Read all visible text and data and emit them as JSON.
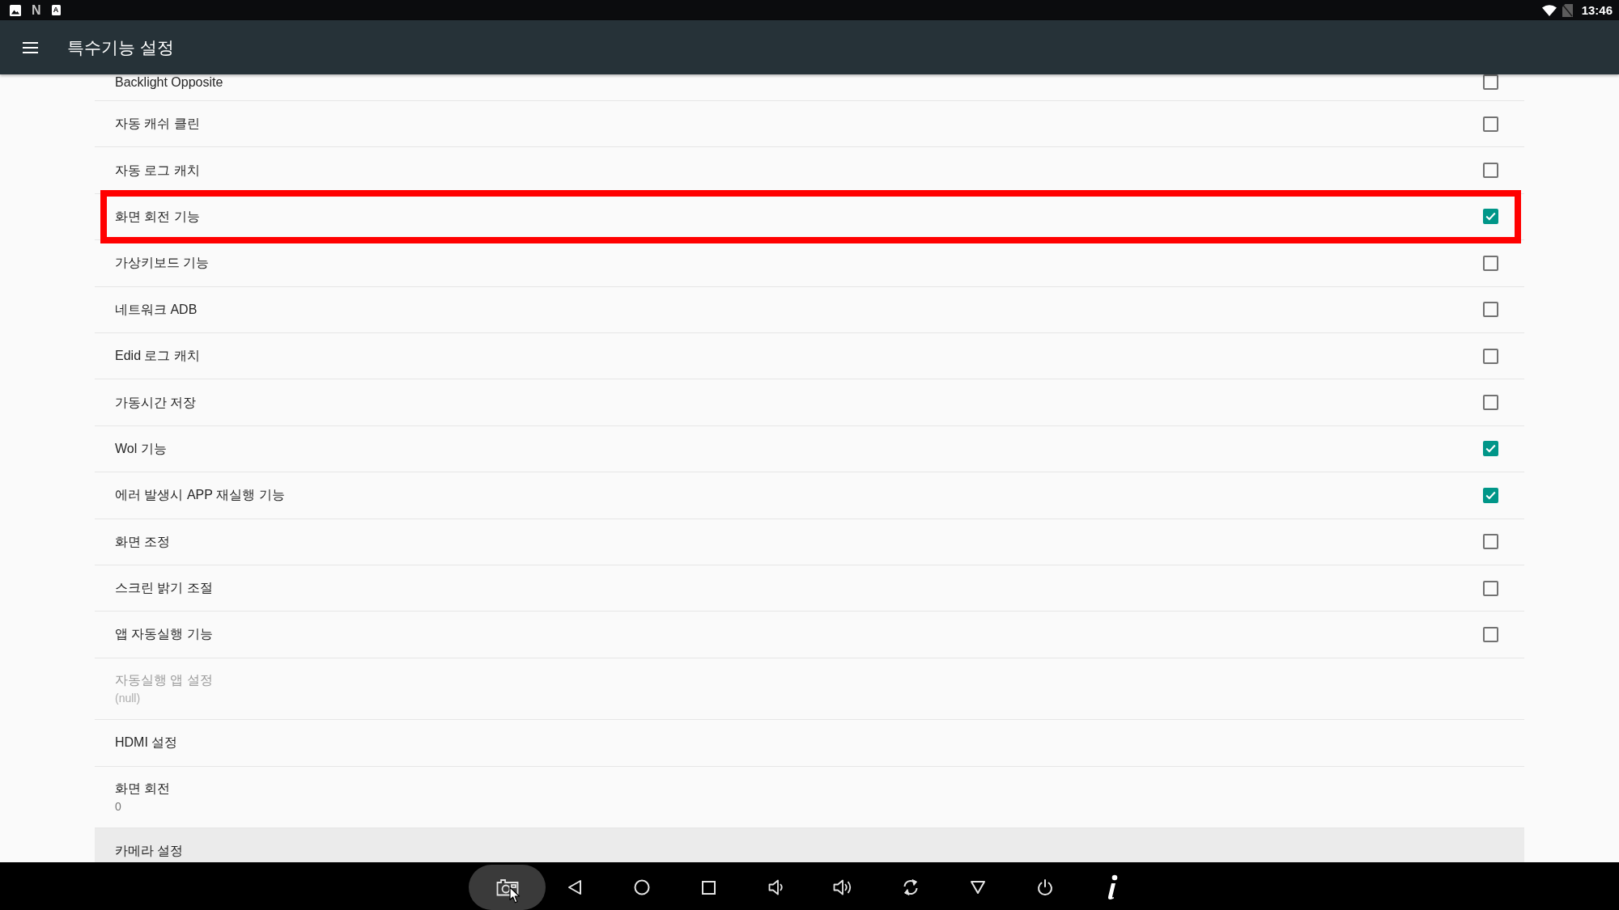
{
  "status_bar": {
    "notifications": [
      {
        "kind": "image"
      },
      {
        "kind": "letter",
        "glyph": "N"
      },
      {
        "kind": "tile",
        "glyph": "A"
      }
    ],
    "time": "13:46"
  },
  "app_bar": {
    "title": "특수기능 설정"
  },
  "settings": [
    {
      "kind": "checkbox",
      "title": "Backlight Opposite",
      "checked": false,
      "disabled": false,
      "highlighted": false,
      "focused": false
    },
    {
      "kind": "checkbox",
      "title": "자동 캐쉬 클린",
      "checked": false,
      "disabled": false,
      "highlighted": false,
      "focused": false
    },
    {
      "kind": "checkbox",
      "title": "자동 로그 캐치",
      "checked": false,
      "disabled": false,
      "highlighted": false,
      "focused": false
    },
    {
      "kind": "checkbox",
      "title": "화면 회전 기능",
      "checked": true,
      "disabled": false,
      "highlighted": true,
      "focused": false
    },
    {
      "kind": "checkbox",
      "title": "가상키보드 기능",
      "checked": false,
      "disabled": false,
      "highlighted": false,
      "focused": false
    },
    {
      "kind": "checkbox",
      "title": "네트워크 ADB",
      "checked": false,
      "disabled": false,
      "highlighted": false,
      "focused": false
    },
    {
      "kind": "checkbox",
      "title": "Edid 로그 캐치",
      "checked": false,
      "disabled": false,
      "highlighted": false,
      "focused": false
    },
    {
      "kind": "checkbox",
      "title": "가동시간 저장",
      "checked": false,
      "disabled": false,
      "highlighted": false,
      "focused": false
    },
    {
      "kind": "checkbox",
      "title": "Wol 기능",
      "checked": true,
      "disabled": false,
      "highlighted": false,
      "focused": false
    },
    {
      "kind": "checkbox",
      "title": "에러 발생시 APP 재실행 기능",
      "checked": true,
      "disabled": false,
      "highlighted": false,
      "focused": false
    },
    {
      "kind": "checkbox",
      "title": "화면 조정",
      "checked": false,
      "disabled": false,
      "highlighted": false,
      "focused": false
    },
    {
      "kind": "checkbox",
      "title": "스크린 밝기 조절",
      "checked": false,
      "disabled": false,
      "highlighted": false,
      "focused": false
    },
    {
      "kind": "checkbox",
      "title": "앱 자동실행 기능",
      "checked": false,
      "disabled": false,
      "highlighted": false,
      "focused": false
    },
    {
      "kind": "link",
      "title": "자동실행 앱 설정",
      "summary": "(null)",
      "disabled": true,
      "highlighted": false,
      "focused": false
    },
    {
      "kind": "link",
      "title": "HDMI 설정",
      "disabled": false,
      "highlighted": false,
      "focused": false
    },
    {
      "kind": "link",
      "title": "화면 회전",
      "summary": "0",
      "disabled": false,
      "highlighted": false,
      "focused": false
    },
    {
      "kind": "link",
      "title": "카메라 설정",
      "disabled": false,
      "highlighted": false,
      "focused": true
    }
  ],
  "nav_bar": {
    "buttons": [
      {
        "kind": "screenshot",
        "selected": true,
        "hovered": true
      },
      {
        "kind": "back",
        "selected": false,
        "hovered": false
      },
      {
        "kind": "home",
        "selected": false,
        "hovered": false
      },
      {
        "kind": "recents",
        "selected": false,
        "hovered": false
      },
      {
        "kind": "volume_down",
        "selected": false,
        "hovered": false
      },
      {
        "kind": "volume_up",
        "selected": false,
        "hovered": false
      },
      {
        "kind": "rotate",
        "selected": false,
        "hovered": false
      },
      {
        "kind": "hide",
        "selected": false,
        "hovered": false
      },
      {
        "kind": "power",
        "selected": false,
        "hovered": false
      },
      {
        "kind": "info",
        "selected": false,
        "hovered": false
      }
    ]
  }
}
